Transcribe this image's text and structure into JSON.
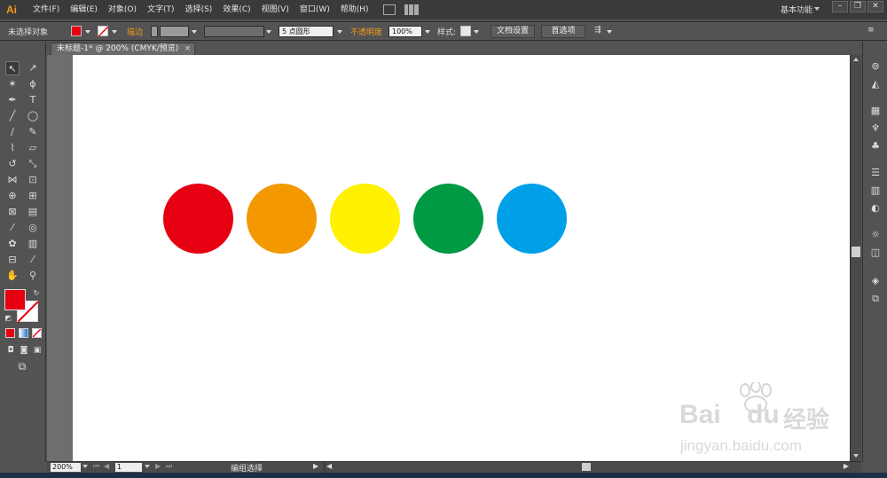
{
  "app": {
    "logo": "Ai"
  },
  "menu": [
    "文件(F)",
    "编辑(E)",
    "对象(O)",
    "文字(T)",
    "选择(S)",
    "效果(C)",
    "视图(V)",
    "窗口(W)",
    "帮助(H)"
  ],
  "workspace": "基本功能",
  "window_controls": [
    "–",
    "❐",
    "✕"
  ],
  "control_bar": {
    "selection_label": "未选择对象",
    "fill_color": "#e60012",
    "stroke_label": "描边",
    "brush_label": "5 点圆形",
    "opacity_label": "不透明度",
    "opacity_value": "100%",
    "style_label": "样式:",
    "doc_setup_button": "文档设置",
    "preferences_button": "首选项"
  },
  "document_tab": {
    "title": "未标题-1* @ 200% (CMYK/预览)",
    "close": "×"
  },
  "circles": [
    {
      "name": "red",
      "color": "#e60012"
    },
    {
      "name": "orange",
      "color": "#f39800"
    },
    {
      "name": "yellow",
      "color": "#fff100"
    },
    {
      "name": "green",
      "color": "#009944"
    },
    {
      "name": "blue",
      "color": "#00a0e9"
    }
  ],
  "status_bar": {
    "zoom": "200%",
    "page": "1",
    "status_text": "编组选择"
  },
  "watermark": {
    "brand": "Bai",
    "brand2": "du",
    "cn": "经验",
    "url": "jingyan.baidu.com"
  },
  "tools": [
    "selection-tool",
    "direct-selection-tool",
    "magic-wand-tool",
    "lasso-tool",
    "pen-tool",
    "type-tool",
    "line-tool",
    "ellipse-tool",
    "paintbrush-tool",
    "pencil-tool",
    "blob-brush-tool",
    "eraser-tool",
    "rotate-tool",
    "scale-tool",
    "width-tool",
    "free-transform-tool",
    "shape-builder-tool",
    "perspective-grid-tool",
    "mesh-tool",
    "gradient-tool",
    "eyedropper-tool",
    "blend-tool",
    "symbol-sprayer-tool",
    "column-graph-tool",
    "artboard-tool",
    "slice-tool",
    "hand-tool",
    "zoom-tool"
  ],
  "right_panels": [
    "color-panel",
    "color-guide-panel",
    "swatches-panel",
    "brushes-panel",
    "symbols-panel",
    "stroke-panel",
    "gradient-panel",
    "transparency-panel",
    "appearance-panel",
    "graphic-styles-panel",
    "layers-panel",
    "artboards-panel"
  ]
}
